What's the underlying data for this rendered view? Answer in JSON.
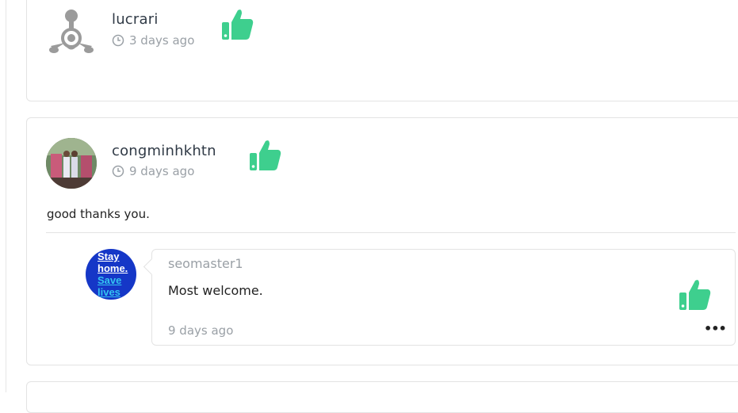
{
  "colors": {
    "like_green": "#3ecf8e",
    "muted": "#9aa0a6",
    "border": "#e3e3e3",
    "stay_blue": "#1537c7"
  },
  "comments": [
    {
      "username": "lucrari",
      "time": "3 days ago",
      "avatar_icon": "default-user-icon",
      "like_icon": "thumbs-up-icon"
    },
    {
      "username": "congminhkhtn",
      "time": "9 days ago",
      "avatar_icon": "user-photo",
      "like_icon": "thumbs-up-icon",
      "text": "good thanks you.",
      "reply": {
        "username": "seomaster1",
        "text": "Most welcome.",
        "time": "9 days ago",
        "avatar_lines": [
          "Stay",
          "home.",
          "Save",
          "lives"
        ],
        "more_label": "•••",
        "like_icon": "thumbs-up-icon"
      }
    }
  ]
}
